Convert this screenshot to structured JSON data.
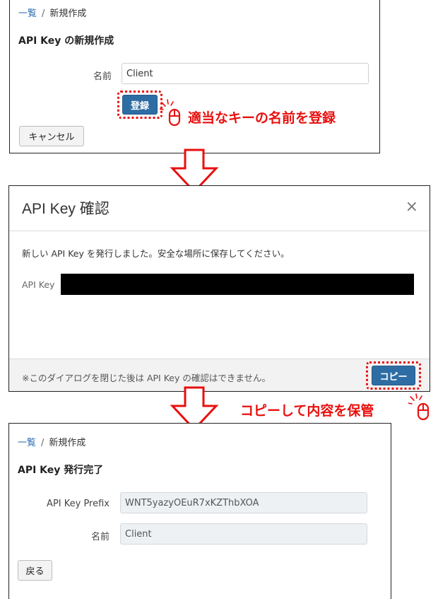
{
  "step1": {
    "breadcrumb": {
      "list_link": "一覧",
      "separator": "/",
      "current": "新規作成"
    },
    "title": "API Key の新規作成",
    "name_label": "名前",
    "name_value": "Client",
    "register_button": "登録",
    "cancel_button": "キャンセル",
    "annotation": "適当なキーの名前を登録"
  },
  "step2": {
    "title": "API Key 確認",
    "close_symbol": "×",
    "message": "新しい API Key を発行しました。安全な場所に保存してください。",
    "key_label": "API Key",
    "footer_note": "※このダイアログを閉じた後は API Key の確認はできません。",
    "copy_button": "コピー",
    "annotation": "コピーして内容を保管"
  },
  "step3": {
    "breadcrumb": {
      "list_link": "一覧",
      "separator": "/",
      "current": "新規作成"
    },
    "title": "API Key 発行完了",
    "prefix_label": "API Key Prefix",
    "prefix_value": "WNT5yazyOEuR7xKZThbXOA",
    "name_label": "名前",
    "name_value": "Client",
    "back_button": "戻る"
  },
  "colors": {
    "annotation": "#e8100e",
    "primary": "#2e6da4",
    "link": "#2a6db2"
  },
  "icons": [
    "mouse-click-icon",
    "down-arrow-icon",
    "close-icon"
  ]
}
